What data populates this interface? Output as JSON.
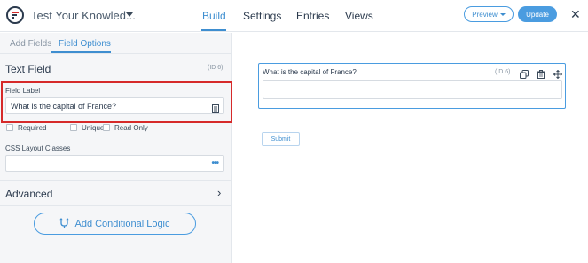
{
  "header": {
    "form_title": "Test Your Knowled...",
    "tabs": [
      {
        "label": "Build"
      },
      {
        "label": "Settings"
      },
      {
        "label": "Entries"
      },
      {
        "label": "Views"
      }
    ],
    "active_tab": "Build",
    "preview_label": "Preview",
    "update_label": "Update",
    "close_glyph": "✕"
  },
  "sidebar": {
    "tabs": [
      {
        "label": "Add Fields"
      },
      {
        "label": "Field Options"
      }
    ],
    "active_tab": "Field Options",
    "field_type": "Text Field",
    "field_id": "(ID 6)",
    "field_label_title": "Field Label",
    "field_label_value": "What is the capital of France?",
    "checkboxes": [
      {
        "label": "Required",
        "checked": false
      },
      {
        "label": "Unique",
        "checked": false
      },
      {
        "label": "Read Only",
        "checked": false
      }
    ],
    "css_classes_title": "CSS Layout Classes",
    "css_classes_value": "",
    "css_more_glyph": "•••",
    "advanced_label": "Advanced",
    "advanced_chevron": "›",
    "conditional_logic_label": "Add Conditional Logic"
  },
  "canvas": {
    "field": {
      "label": "What is the capital of France?",
      "id": "(ID 6)",
      "value": ""
    },
    "submit_label": "Submit"
  },
  "icons": {
    "logo": "formidable-logo-icon",
    "title_caret": "caret-down-icon",
    "field_label_doc": "document-icon",
    "duplicate": "duplicate-icon",
    "delete": "trash-icon",
    "move": "move-icon",
    "conditional": "branch-icon"
  },
  "colors": {
    "accent": "#3e8ed0",
    "highlight": "#d62a2a",
    "sidebar_bg": "#f5f6f8",
    "text": "#2b3a4d"
  }
}
